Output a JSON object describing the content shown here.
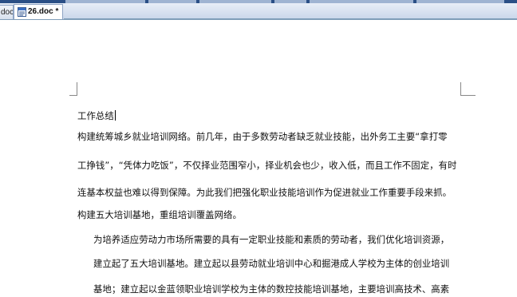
{
  "window": {
    "tabs": [
      {
        "label": "doc",
        "active": false
      },
      {
        "label": "26.doc *",
        "active": true
      }
    ],
    "accent_color": "#2a4f86"
  },
  "document": {
    "lines": [
      "工作总结",
      "构建统筹城乡就业培训网络。前几年，由于多数劳动者缺乏就业技能，出外务工主要“拿打零",
      "工挣钱”，“凭体力吃饭”，不仅择业范围窄小，择业机会也少，收入低，而且工作不固定，有时",
      "连基本权益也难以得到保障。为此我们把强化职业技能培训作为促进就业工作重要手段来抓。",
      "构建五大培训基地，重组培训覆盖网络。",
      "为培养适应劳动力市场所需要的具有一定职业技能和素质的劳动者，我们优化培训资源，",
      "建立起了五大培训基地。建立起以县劳动就业培训中心和掘港成人学校为主体的创业培训",
      "基地；建立起以金蓝领职业培训学校为主体的数控技能培训基地，主要培训高技术、高素"
    ]
  }
}
